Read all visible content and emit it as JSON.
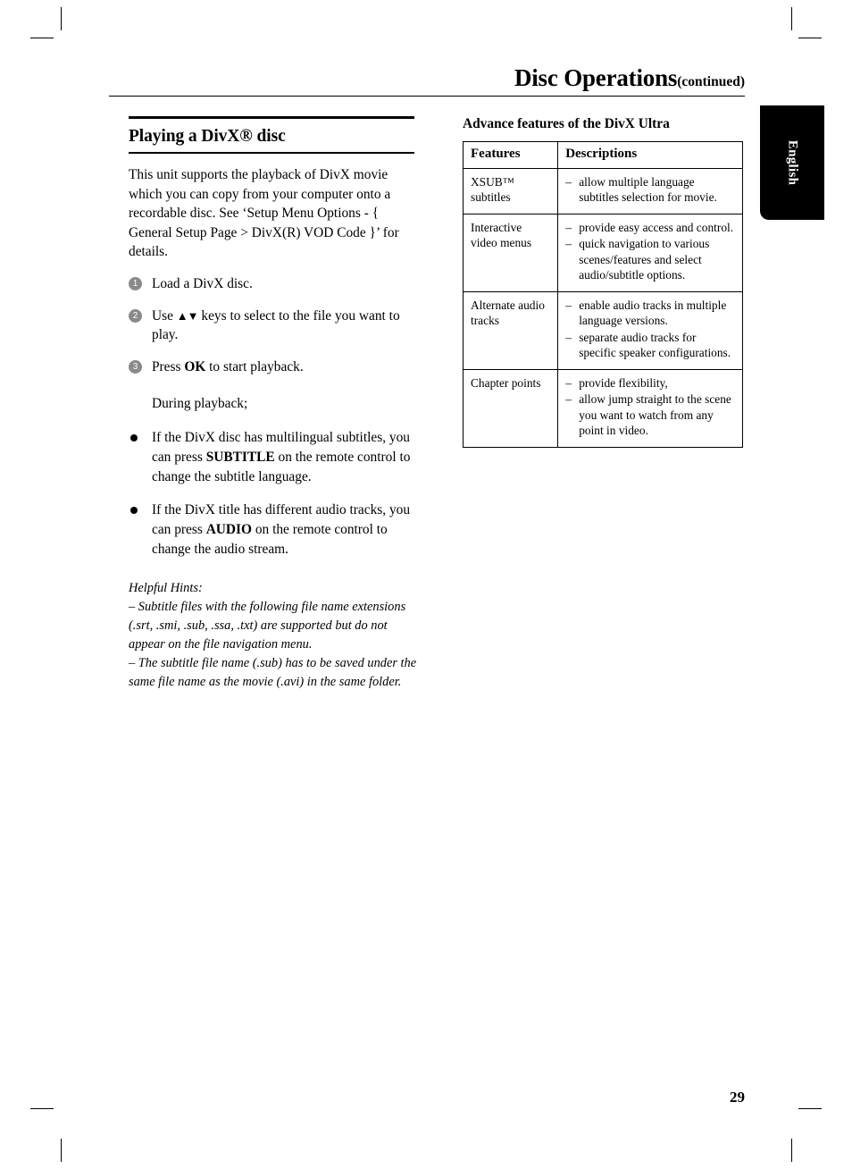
{
  "header": {
    "title": "Disc Operations",
    "continued": "(continued)"
  },
  "language_tab": {
    "label": "English"
  },
  "left": {
    "section_title": "Playing a DivX® disc",
    "intro": "This unit supports the playback of DivX movie which you can copy from your computer onto a recordable disc. See ‘Setup Menu Options - { General Setup Page > DivX(R) VOD Code }’ for details.",
    "steps": [
      {
        "num": "1",
        "text": "Load a DivX disc."
      },
      {
        "num": "2",
        "text_before": "Use ",
        "arrows": "▲▼",
        "text_after": " keys to select to the file you want to play."
      },
      {
        "num": "3",
        "text_before": "Press ",
        "bold": "OK",
        "text_after": " to start playback."
      }
    ],
    "during_label": "During playback;",
    "bullets": [
      {
        "before": "If the DivX disc has multilingual subtitles, you can press ",
        "bold": "SUBTITLE",
        "after": " on the remote control to change the subtitle language."
      },
      {
        "before": "If the DivX title has different audio tracks, you can press ",
        "bold": "AUDIO",
        "after": " on the remote control to change the audio stream."
      }
    ],
    "hints_title": "Helpful Hints:",
    "hints": [
      "–  Subtitle files with the following file name extensions (.srt, .smi, .sub, .ssa, .txt) are supported but do not appear on the file navigation menu.",
      "–  The subtitle file name (.sub) has to be saved under the same file name as the movie (.avi) in the same folder."
    ]
  },
  "right": {
    "heading": "Advance features of the DivX Ultra",
    "table": {
      "columns": [
        "Features",
        "Descriptions"
      ],
      "rows": [
        {
          "feature": "XSUB™ subtitles",
          "descriptions": [
            "allow multiple language subtitles selection for movie."
          ]
        },
        {
          "feature": "Interactive video menus",
          "descriptions": [
            "provide easy access and control.",
            "quick navigation to various scenes/features and select audio/subtitle options."
          ]
        },
        {
          "feature": "Alternate audio tracks",
          "descriptions": [
            "enable audio tracks in multiple language versions.",
            "separate audio tracks for specific speaker configurations."
          ]
        },
        {
          "feature": "Chapter points",
          "descriptions": [
            "provide flexibility,",
            "allow jump straight to the scene you want to watch from any point in video."
          ]
        }
      ]
    }
  },
  "page_number": "29"
}
